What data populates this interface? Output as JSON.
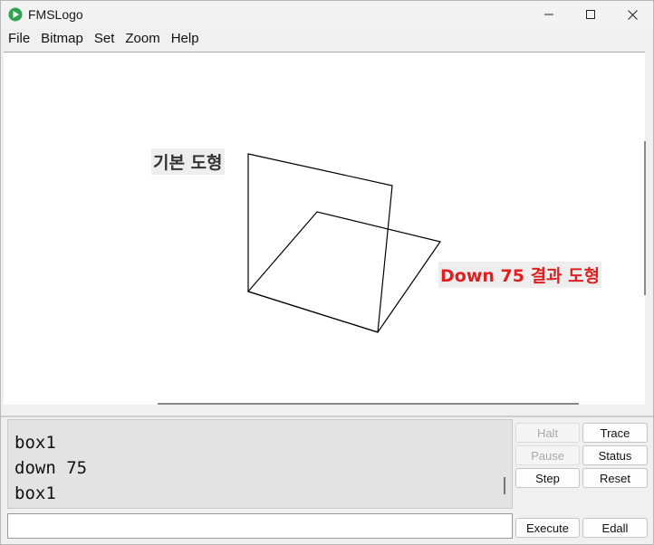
{
  "window": {
    "title": "FMSLogo"
  },
  "menu": [
    "File",
    "Bitmap",
    "Set",
    "Zoom",
    "Help"
  ],
  "canvas": {
    "label_basic": "기본 도형",
    "label_result": "Down 75 결과 도형"
  },
  "history": [
    "box1",
    "down 75",
    "box1"
  ],
  "input": {
    "value": "",
    "placeholder": ""
  },
  "buttons": {
    "halt": "Halt",
    "trace": "Trace",
    "pause": "Pause",
    "status": "Status",
    "step": "Step",
    "reset": "Reset",
    "execute": "Execute",
    "edall": "Edall"
  },
  "colors": {
    "result_label": "#e02020",
    "app_icon": "#2ea44f"
  }
}
